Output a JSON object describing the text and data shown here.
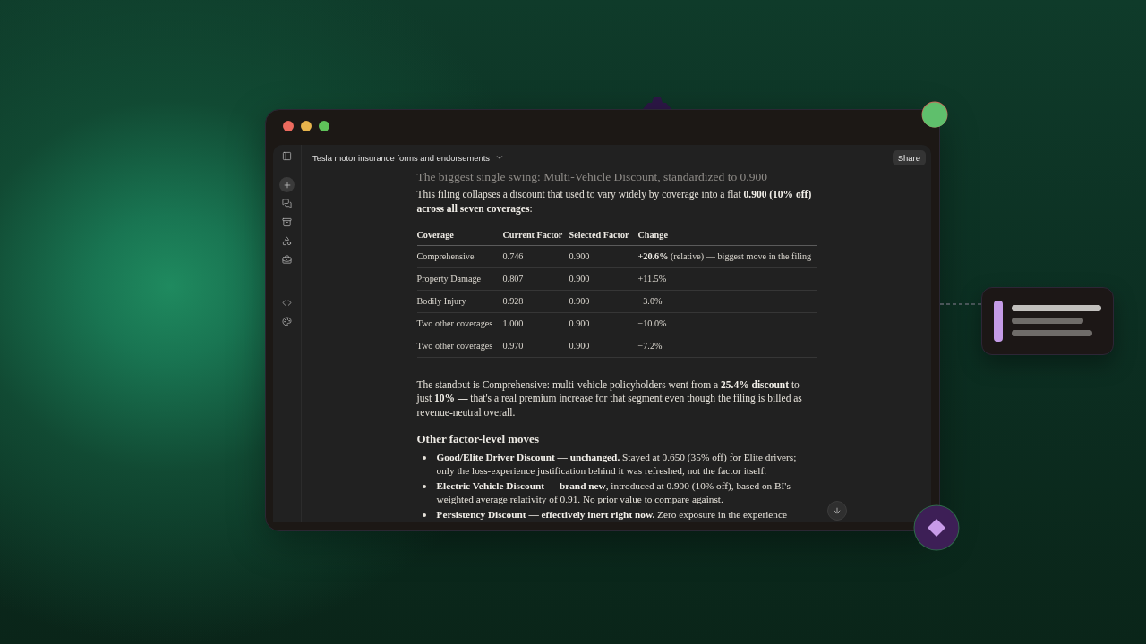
{
  "window": {
    "title": "Tesla motor insurance forms and endorsements",
    "share_button": "Share"
  },
  "document": {
    "heading": "The biggest single swing: Multi-Vehicle Discount, standardized to 0.900",
    "intro": "This filing collapses a discount that used to vary widely by coverage into a flat **0.900 (10% off) across all seven coverages**:",
    "table": {
      "columns": [
        "Coverage",
        "Current Factor",
        "Selected Factor",
        "Change"
      ],
      "rows": [
        [
          "Comprehensive",
          "0.746",
          "0.900",
          "**+20.6%** (relative) — biggest move in the filing"
        ],
        [
          "Property Damage",
          "0.807",
          "0.900",
          "+11.5%"
        ],
        [
          "Bodily Injury",
          "0.928",
          "0.900",
          "−3.0%"
        ],
        [
          "Two other coverages",
          "1.000",
          "0.900",
          "−10.0%"
        ],
        [
          "Two other coverages",
          "0.970",
          "0.900",
          "−7.2%"
        ]
      ]
    },
    "standout": "The standout is Comprehensive: multi-vehicle policyholders went from a **25.4% discount** to just **10% —** that's a real premium increase for that segment even though the filing is billed as revenue-neutral overall.",
    "section_heading": "Other factor-level moves",
    "bullets": [
      "**Good/Elite Driver Discount — unchanged.** Stayed at 0.650 (35% off) for Elite drivers; only the loss-experience justification behind it was refreshed, not the factor itself.",
      "**Electric Vehicle Discount — brand new**, introduced at 0.900 (10% off), based on BI's weighted average relativity of 0.91. No prior value to compare against.",
      "**Persistency Discount — effectively inert right now.** Zero exposure in the experience"
    ]
  }
}
